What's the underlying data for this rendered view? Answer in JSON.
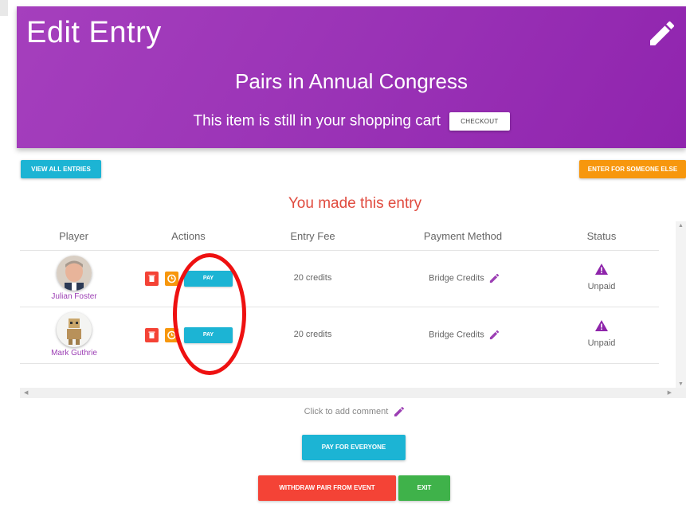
{
  "header": {
    "title": "Edit Entry",
    "event_name": "Pairs in Annual Congress",
    "cart_message": "This item is still in your shopping cart",
    "checkout_label": "CHECKOUT",
    "edit_icon": "pencil-icon"
  },
  "toolbar": {
    "view_all_label": "VIEW ALL ENTRIES",
    "enter_else_label": "ENTER FOR SOMEONE ELSE"
  },
  "entry_message": "You made this entry",
  "table": {
    "headers": [
      "Player",
      "Actions",
      "Entry Fee",
      "Payment Method",
      "Status"
    ],
    "rows": [
      {
        "player": "Julian Foster",
        "pay_label": "PAY",
        "fee": "20 credits",
        "method": "Bridge Credits",
        "status": "Unpaid"
      },
      {
        "player": "Mark Guthrie",
        "pay_label": "PAY",
        "fee": "20 credits",
        "method": "Bridge Credits",
        "status": "Unpaid"
      }
    ]
  },
  "comment_label": "Click to add comment",
  "buttons": {
    "pay_everyone": "PAY FOR EVERYONE",
    "withdraw": "WITHDRAW PAIR FROM EVENT",
    "exit": "EXIT"
  },
  "colors": {
    "header": "#9a33b6",
    "cyan": "#1cb4d4",
    "orange": "#f7970d",
    "red": "#f44336",
    "green": "#3fb24a",
    "purple_text": "#9c3fb4",
    "annotation": "#ee1111"
  }
}
